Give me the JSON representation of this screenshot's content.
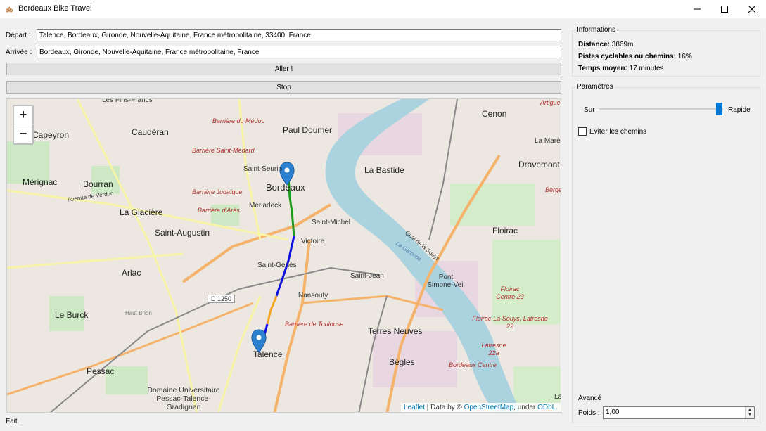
{
  "window": {
    "title": "Bordeaux Bike Travel",
    "icon": "bike-app-icon"
  },
  "form": {
    "depart_label": "Départ :",
    "depart_value": "Talence, Bordeaux, Gironde, Nouvelle-Aquitaine, France métropolitaine, 33400, France",
    "arrivee_label": "Arrivée :",
    "arrivee_value": "Bordeaux, Gironde, Nouvelle-Aquitaine, France métropolitaine, France",
    "go_label": "Aller !",
    "stop_label": "Stop"
  },
  "map": {
    "zoom_in": "+",
    "zoom_out": "−",
    "attribution": {
      "leaflet": "Leaflet",
      "sep": " | Data by © ",
      "osm": "OpenStreetMap",
      "under": ", under ",
      "odbl": "ODbL",
      "end": "."
    },
    "places": [
      {
        "name": "Les Fins-Francs"
      },
      {
        "name": "Paul Doumer"
      },
      {
        "name": "Cenon"
      },
      {
        "name": "Caudéran"
      },
      {
        "name": "Capeyron"
      },
      {
        "name": "Saint-Seurin"
      },
      {
        "name": "Bordeaux"
      },
      {
        "name": "La Bastide"
      },
      {
        "name": "Dravemont"
      },
      {
        "name": "La Marè"
      },
      {
        "name": "Mérignac"
      },
      {
        "name": "Bourran"
      },
      {
        "name": "La Glacière"
      },
      {
        "name": "Mériadeck"
      },
      {
        "name": "Saint-Augustin"
      },
      {
        "name": "Saint-Michel"
      },
      {
        "name": "Floirac"
      },
      {
        "name": "Victoire"
      },
      {
        "name": "Saint-Genès"
      },
      {
        "name": "Arlac"
      },
      {
        "name": "Saint-Jean"
      },
      {
        "name": "Pont Simone-Veil"
      },
      {
        "name": "Nansouty"
      },
      {
        "name": "Le Burck"
      },
      {
        "name": "Terres Neuves"
      },
      {
        "name": "Talence"
      },
      {
        "name": "Bègles"
      },
      {
        "name": "Pessac"
      },
      {
        "name": "Domaine Universitaire Pessac-Talence-Gradignan"
      },
      {
        "name": "La"
      }
    ],
    "red_labels": [
      {
        "name": "Barrière du Médoc"
      },
      {
        "name": "Barrière Saint-Médard"
      },
      {
        "name": "Barrière Judaïque"
      },
      {
        "name": "Barrière d'Arès"
      },
      {
        "name": "Barrière de Toulouse"
      },
      {
        "name": "Floirac Centre 23"
      },
      {
        "name": "Floirac-La Souys, Latresne 22"
      },
      {
        "name": "Latresne 22a"
      },
      {
        "name": "Bordeaux Centre"
      },
      {
        "name": "Artigue"
      },
      {
        "name": "Berge"
      }
    ],
    "road_shield": "D 1250",
    "small_labels": [
      {
        "name": "Avenue de Verdun"
      },
      {
        "name": "Quai de la Souys"
      },
      {
        "name": "La Garonne"
      },
      {
        "name": "Haut Brion"
      }
    ],
    "route_colors": [
      "#2b6cb0",
      "#1a9b1a",
      "#1010e0",
      "#f5a623"
    ]
  },
  "info": {
    "group_title": "Informations",
    "distance_label": "Distance:",
    "distance_value": " 3869m",
    "pistes_label": "Pistes cyclables ou chemins:",
    "pistes_value": " 16%",
    "temps_label": "Temps moyen:",
    "temps_value": " 17 minutes"
  },
  "params": {
    "group_title": "Paramètres",
    "slider_left": "Sur",
    "slider_right": "Rapide",
    "slider_level": 1.0,
    "avoid_paths_label": "Eviter les chemins",
    "avoid_paths_checked": false
  },
  "advanced": {
    "title": "Avancé",
    "weight_label": "Poids :",
    "weight_value": "1,00"
  },
  "status": "Fait."
}
